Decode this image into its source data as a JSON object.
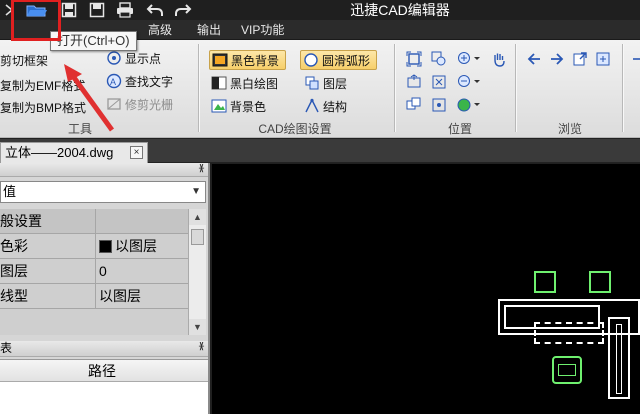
{
  "app": {
    "title": "迅捷CAD编辑器"
  },
  "quick_access": {
    "icons": [
      "app-menu-icon",
      "open-file-icon",
      "save-icon",
      "print-icon",
      "undo-icon",
      "redo-icon"
    ]
  },
  "menu": {
    "items": [
      "高级",
      "输出",
      "VIP功能"
    ]
  },
  "tooltip": {
    "text": "打开(Ctrl+O)"
  },
  "ribbon": {
    "tools_group": {
      "label": "工具",
      "items": [
        {
          "label": "剪切框架"
        },
        {
          "label": "复制为EMF格式"
        },
        {
          "label": "复制为BMP格式"
        },
        {
          "label": "显示点"
        },
        {
          "label": "查找文字"
        },
        {
          "label": "修剪光栅"
        }
      ]
    },
    "draw_group": {
      "label": "CAD绘图设置",
      "items": [
        {
          "label": "黑色背景"
        },
        {
          "label": "黑白绘图"
        },
        {
          "label": "背景色"
        },
        {
          "label": "圆滑弧形"
        },
        {
          "label": "图层"
        },
        {
          "label": "结构"
        }
      ]
    },
    "position_group": {
      "label": "位置"
    },
    "browse_group": {
      "label": "浏览"
    }
  },
  "document_tab": {
    "label": "立体——2004.dwg",
    "close_symbol": "×"
  },
  "properties": {
    "selector_value": "值",
    "rows": [
      {
        "name": "般设置",
        "value": ""
      },
      {
        "name": "色彩",
        "value": "以图层"
      },
      {
        "name": "图层",
        "value": "0"
      },
      {
        "name": "线型",
        "value": "以图层"
      }
    ]
  },
  "layers_panel": {
    "title": "表",
    "column_path": "路径"
  },
  "colors": {
    "canvas": "#000000",
    "cad_green": "#6ff06f",
    "highlight_red": "#e02020"
  }
}
